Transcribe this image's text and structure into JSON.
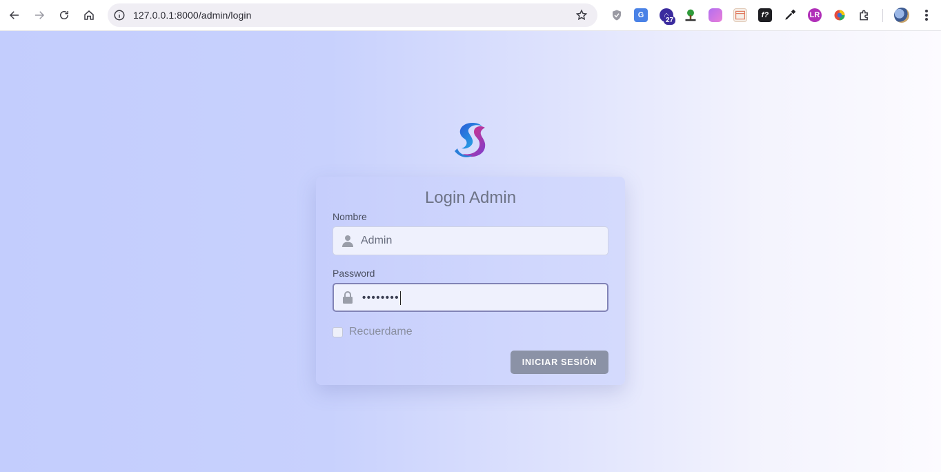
{
  "browser": {
    "url": "127.0.0.1:8000/admin/login",
    "extension_badge": "27",
    "icons": [
      "back-icon",
      "forward-icon",
      "reload-icon",
      "home-icon",
      "site-info-icon",
      "bookmark-star-icon",
      "extensions-puzzle-icon",
      "profile-avatar",
      "more-menu-icon"
    ]
  },
  "login": {
    "title": "Login Admin",
    "name_label": "Nombre",
    "name_value": "Admin",
    "password_label": "Password",
    "password_mask": "••••••••",
    "remember_label": "Recuerdame",
    "submit_label": "INICIAR SESIÓN"
  },
  "colors": {
    "page_gradient_start": "#c3cdfd",
    "page_gradient_end": "#fcfbff",
    "button": "#8b92a6",
    "focus_border": "#8183b6"
  }
}
